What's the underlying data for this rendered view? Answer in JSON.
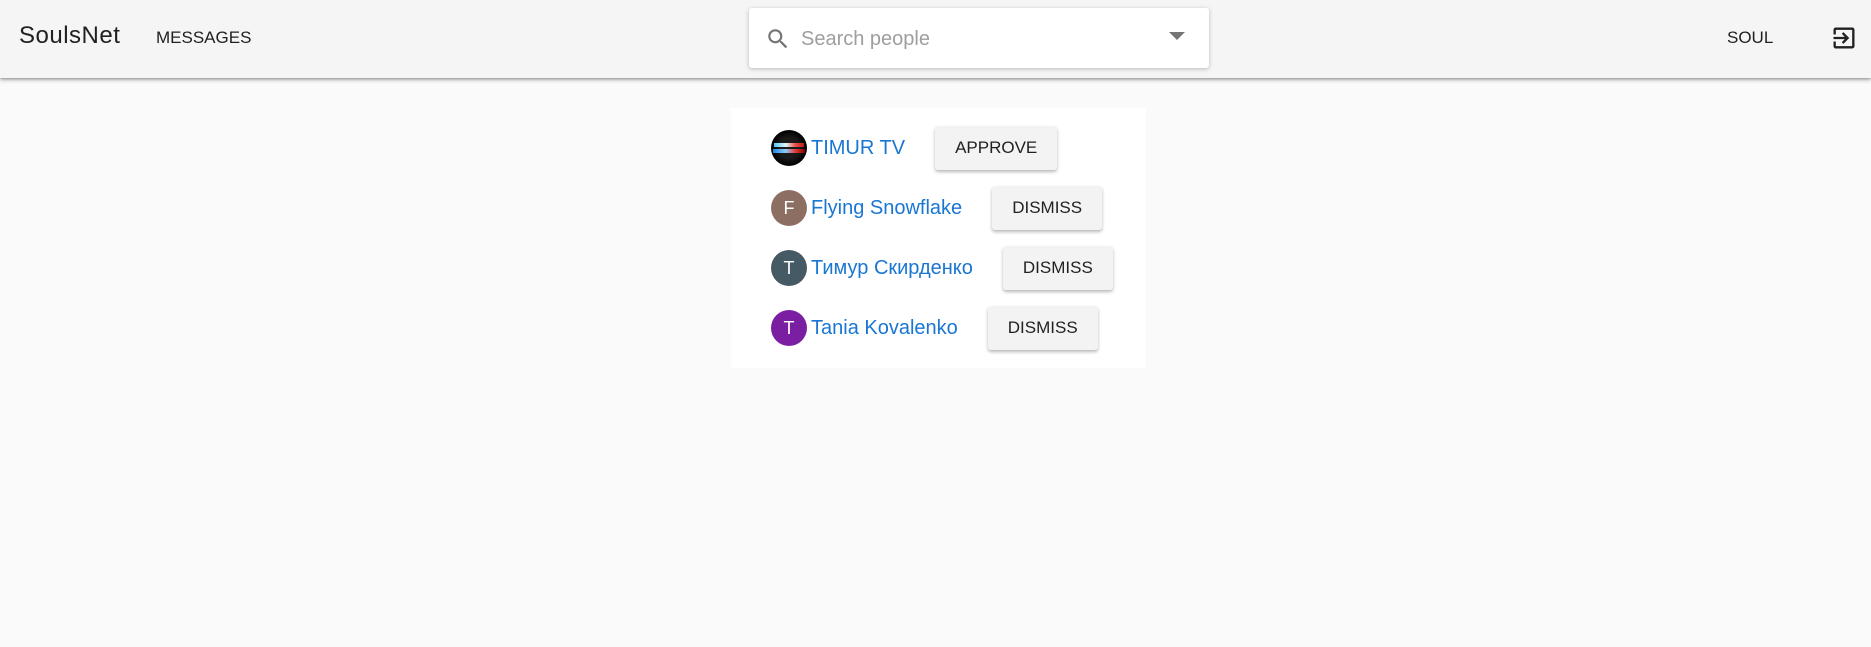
{
  "appbar": {
    "brand": "SoulsNet",
    "nav_messages": "MESSAGES",
    "search": {
      "placeholder": "Search people",
      "value": ""
    },
    "user_label": "SOUL"
  },
  "requests": [
    {
      "name": "TIMUR TV",
      "avatar_letter": "",
      "avatar_color": "#000000",
      "action": "APPROVE"
    },
    {
      "name": "Flying Snowflake",
      "avatar_letter": "F",
      "avatar_color": "#8d6e63",
      "action": "DISMISS"
    },
    {
      "name": "Тимур Скирденко",
      "avatar_letter": "T",
      "avatar_color": "#455a64",
      "action": "DISMISS"
    },
    {
      "name": "Tania Kovalenko",
      "avatar_letter": "T",
      "avatar_color": "#7b1fa2",
      "action": "DISMISS"
    }
  ],
  "colors": {
    "link": "#1976d2",
    "appbar_bg": "#f5f5f5",
    "page_bg": "#fafafa"
  }
}
